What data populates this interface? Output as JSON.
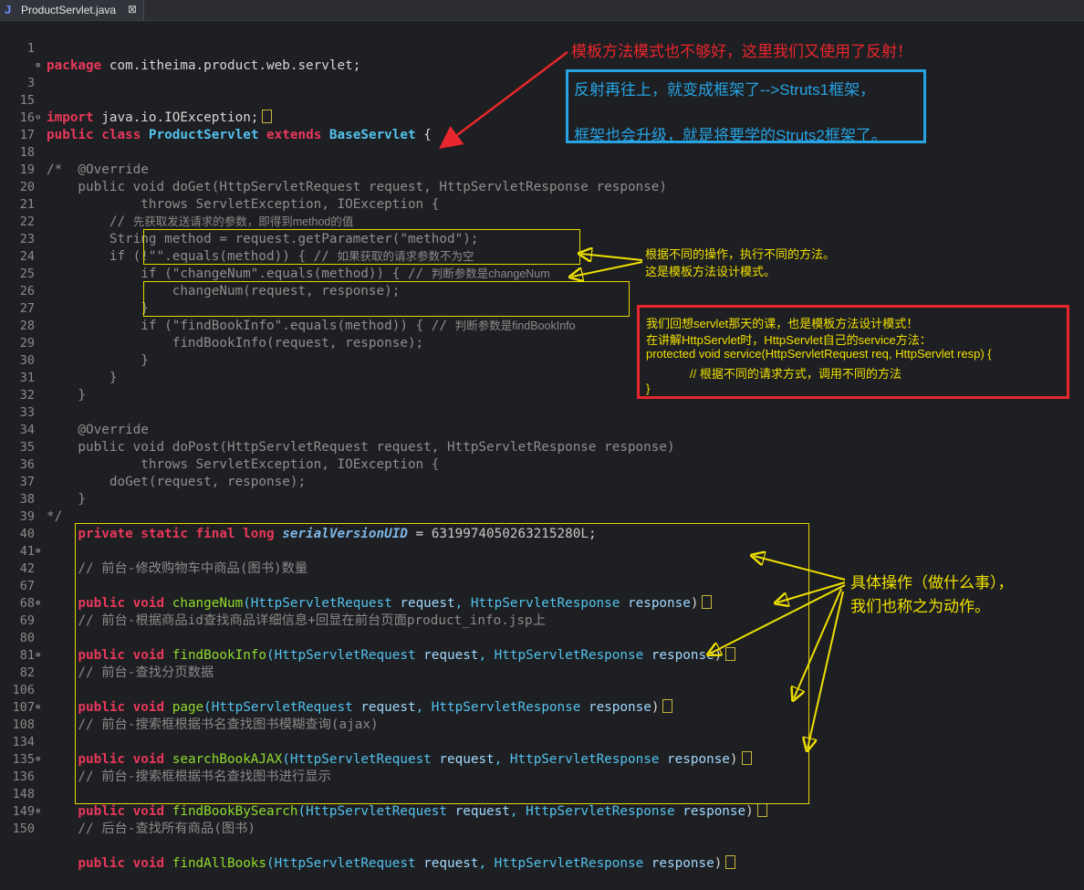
{
  "tab": {
    "icon": "java-file-icon",
    "label": "ProductServlet.java",
    "close": "⊠"
  },
  "code": {
    "l1_num": "1",
    "l1_kw": "package",
    "l1_rest": " com.itheima.product.web.servlet;",
    "l3_num": "3",
    "l3_kw": "import",
    "l3_rest": " java.io.IOException;",
    "l15_num": "15",
    "l16_num": "16",
    "l16_kw1": "public",
    "l16_kw2": " class",
    "l16_cls": " ProductServlet",
    "l16_kw3": " extends",
    "l16_base": " BaseServlet",
    "l16_rest": " {",
    "l17_num": "17",
    "l17_text": "/*",
    "l18_num": "18",
    "l18_text": "    @Override",
    "l19_num": "19",
    "l19_text": "    public void doGet(HttpServletRequest request, HttpServletResponse response)",
    "l20_num": "20",
    "l20_text": "            throws ServletException, IOException {",
    "l21_num": "21",
    "l21_pre": "        // ",
    "l21_cmt": "先获取发送请求的参数，即得到method的值",
    "l22_num": "22",
    "l22_text": "        String method = request.getParameter(\"method\");",
    "l23_num": "23",
    "l23_pre": "        if (!\"\".equals(method)) { // ",
    "l23_cmt": "如果获取的请求参数不为空",
    "l24_num": "24",
    "l24_pre": "            if (\"changeNum\".equals(method)) { // ",
    "l24_cmt": "判断参数是changeNum",
    "l25_num": "25",
    "l25_text": "                changeNum(request, response);",
    "l26_num": "26",
    "l26_text": "            }",
    "l27_num": "27",
    "l27_pre": "            if (\"findBookInfo\".equals(method)) { // ",
    "l27_cmt": "判断参数是findBookInfo",
    "l28_num": "28",
    "l28_text": "                findBookInfo(request, response);",
    "l29_num": "29",
    "l29_text": "            }",
    "l30_num": "30",
    "l30_text": "        }",
    "l31_num": "31",
    "l31_text": "    }",
    "l32_num": "32",
    "l33_num": "33",
    "l33_text": "    @Override",
    "l34_num": "34",
    "l34_text": "    public void doPost(HttpServletRequest request, HttpServletResponse response)",
    "l35_num": "35",
    "l35_text": "            throws ServletException, IOException {",
    "l36_num": "36",
    "l36_text": "        doGet(request, response);",
    "l37_num": "37",
    "l37_text": "    }",
    "l38_num": "38",
    "l38_text": "*/",
    "l39_num": "39",
    "l39_kw": "    private static final long",
    "l39_fld": " serialVersionUID",
    "l39_rest": " = ",
    "l39_val": "6319974050263215280L",
    "l39_end": ";",
    "l40_num": "40",
    "l41_num": "41",
    "l41_cmt": "    // 前台-修改购物车中商品(图书)数量",
    "l42_num": "42",
    "l42_mt": "changeNum",
    "l67_num": "67",
    "l68_num": "68",
    "l68_cmt": "    // 前台-根据商品id查找商品详细信息+回显在前台页面product_info.jsp上",
    "l69_num": "69",
    "l69_mt": "findBookInfo",
    "l80_num": "80",
    "l81_num": "81",
    "l81_cmt": "    // 前台-查找分页数据",
    "l82_num": "82",
    "l82_mt": "page",
    "l106_num": "106",
    "l107_num": "107",
    "l107_cmt": "    // 前台-搜索框根据书名查找图书模糊查询(ajax)",
    "l108_num": "108",
    "l108_mt": "searchBookAJAX",
    "l134_num": "134",
    "l135_num": "135",
    "l135_cmt": "    // 前台-搜索框根据书名查找图书进行显示",
    "l136_num": "136",
    "l136_mt": "findBookBySearch",
    "l148_num": "148",
    "l149_num": "149",
    "l149_cmt": "    // 后台-查找所有商品(图书)",
    "l150_num": "150",
    "l150_mt": "findAllBooks",
    "sig_kw": "    public void ",
    "sig_t1": "(HttpServletRequest",
    "sig_p1": " request",
    "sig_t2": ", HttpServletResponse",
    "sig_p2": " response",
    "sig_end": ")"
  },
  "annotations": {
    "top_red": "模板方法模式也不够好，这里我们又使用了反射！",
    "blue_line1": "反射再往上，就变成框架了-->Struts1框架，",
    "blue_line2": "框架也会升级，就是将要学的Struts2框架了。",
    "template_line1": "根据不同的操作，执行不同的方法。",
    "template_line2": "这是模板方法设计模式。",
    "red_box_line1": "我们回想servlet那天的课，也是模板方法设计模式！",
    "red_box_line2": "在讲解HttpServlet时，HttpServlet自己的service方法：",
    "red_box_line3": "protected void service(HttpServletRequest req, HttpServlet resp) {",
    "red_box_line4": "// 根据不同的请求方式，调用不同的方法",
    "red_box_line5": "}",
    "actions_line1": "具体操作（做什么事），",
    "actions_line2": "我们也称之为动作。"
  },
  "colors": {
    "background": "#1e1f22",
    "keyword": "#e8385a",
    "type": "#52c2ee",
    "method": "#8fdc2e",
    "annotation_red": "#e8262d",
    "annotation_blue": "#27a3e3",
    "annotation_yellow": "#f0e000"
  }
}
